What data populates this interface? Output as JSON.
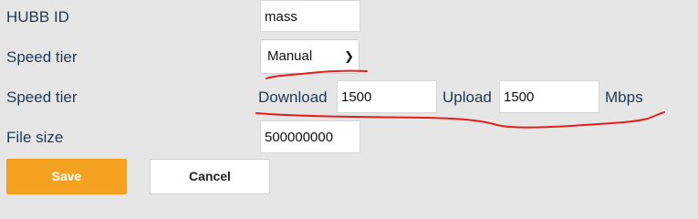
{
  "form": {
    "hubb_id": {
      "label": "HUBB ID",
      "value": "mass"
    },
    "speed_tier_select": {
      "label": "Speed tier",
      "selected": "Manual"
    },
    "speed_tier_manual": {
      "label": "Speed tier",
      "download_label": "Download",
      "download_value": "1500",
      "upload_label": "Upload",
      "upload_value": "1500",
      "unit": "Mbps"
    },
    "file_size": {
      "label": "File size",
      "value": "500000000"
    }
  },
  "actions": {
    "save_label": "Save",
    "cancel_label": "Cancel"
  },
  "colors": {
    "background": "#e6e6e6",
    "label_text": "#1e3a56",
    "save_button": "#f5a223",
    "annotation": "#e0201f"
  }
}
